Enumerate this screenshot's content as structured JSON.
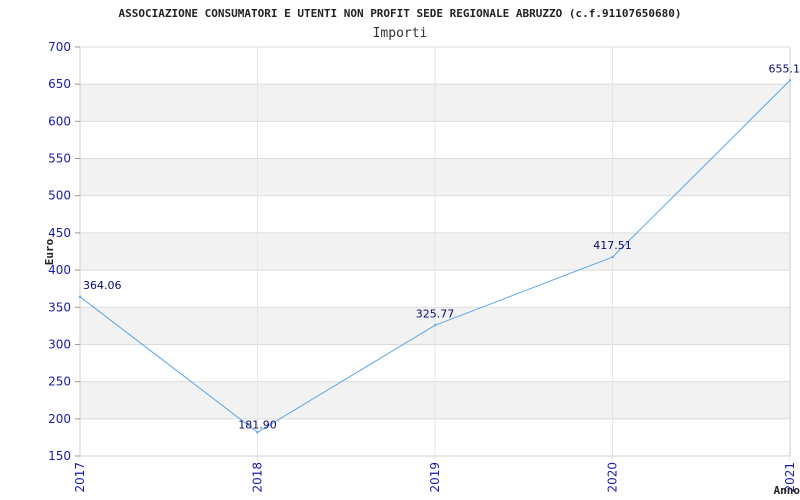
{
  "chart_data": {
    "type": "line",
    "title": "ASSOCIAZIONE CONSUMATORI E UTENTI NON PROFIT SEDE REGIONALE ABRUZZO (c.f.91107650680)",
    "subtitle": "Importi",
    "ylabel": "Euro",
    "xlabel": "Anno",
    "ylim": [
      150,
      700
    ],
    "yticks": [
      "150",
      "200",
      "250",
      "300",
      "350",
      "400",
      "450",
      "500",
      "550",
      "600",
      "650",
      "700"
    ],
    "categories": [
      "2017",
      "2018",
      "2019",
      "2020",
      "2021"
    ],
    "series": [
      {
        "values": [
          364.06,
          181.9,
          325.77,
          417.51,
          655.1
        ],
        "labels": [
          "364.06",
          "181.90",
          "325.77",
          "417.51",
          "655.1"
        ]
      }
    ],
    "grid": true,
    "colors": {
      "line": "#5aa6e6",
      "band": "#f2f2f2",
      "gridline": "#dcdcdc",
      "axis_text": "#1a1aaa",
      "data_label": "#0a0a70"
    }
  }
}
